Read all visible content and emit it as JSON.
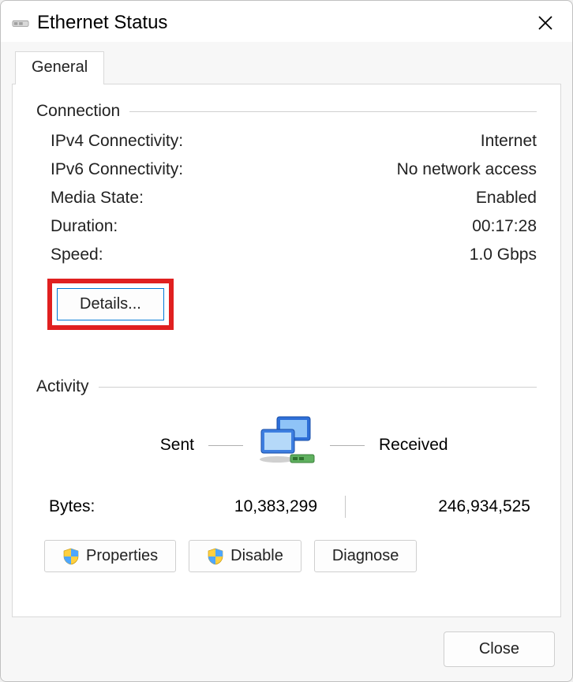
{
  "window": {
    "title": "Ethernet Status"
  },
  "tabs": {
    "general": "General"
  },
  "connection": {
    "title": "Connection",
    "ipv4_label": "IPv4 Connectivity:",
    "ipv4_value": "Internet",
    "ipv6_label": "IPv6 Connectivity:",
    "ipv6_value": "No network access",
    "media_label": "Media State:",
    "media_value": "Enabled",
    "duration_label": "Duration:",
    "duration_value": "00:17:28",
    "speed_label": "Speed:",
    "speed_value": "1.0 Gbps",
    "details_button": "Details..."
  },
  "activity": {
    "title": "Activity",
    "sent_label": "Sent",
    "received_label": "Received",
    "bytes_label": "Bytes:",
    "bytes_sent": "10,383,299",
    "bytes_received": "246,934,525"
  },
  "buttons": {
    "properties": "Properties",
    "disable": "Disable",
    "diagnose": "Diagnose",
    "close": "Close"
  }
}
